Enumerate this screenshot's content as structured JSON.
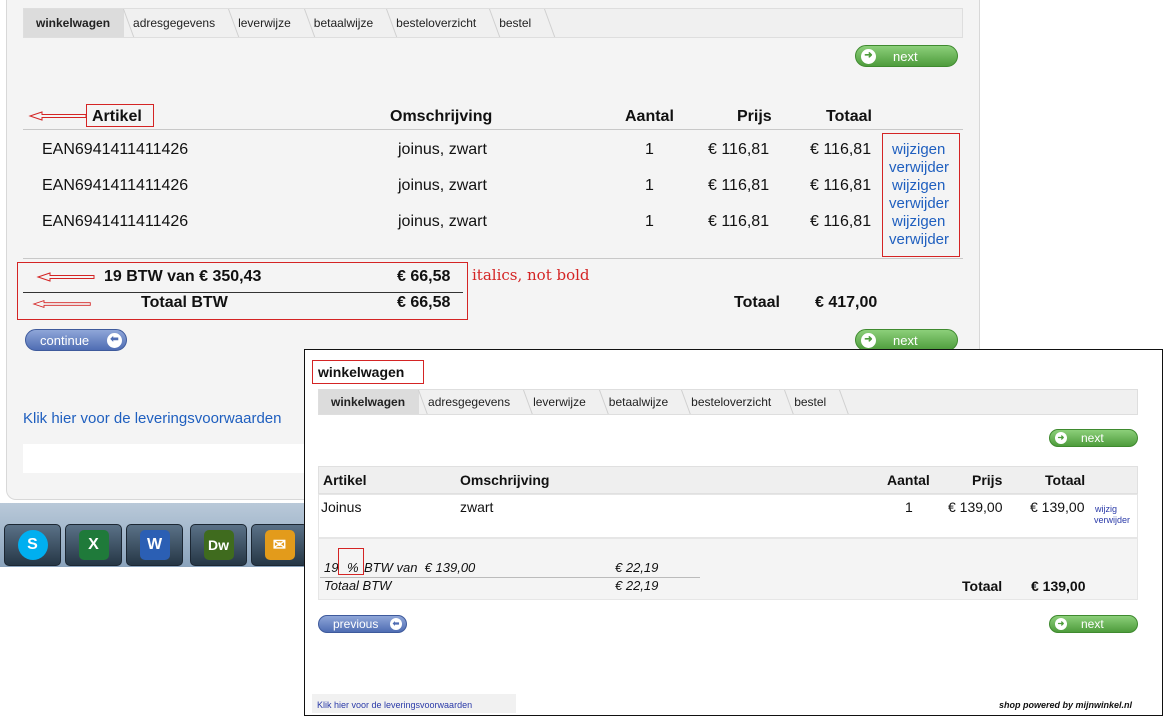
{
  "main": {
    "steps": [
      "winkelwagen",
      "adresgegevens",
      "leverwijze",
      "betaalwijze",
      "besteloverzicht",
      "bestel"
    ],
    "next_label": "next",
    "continue_label": "continue",
    "columns": {
      "artikel": "Artikel",
      "omschrijving": "Omschrijving",
      "aantal": "Aantal",
      "prijs": "Prijs",
      "totaal": "Totaal"
    },
    "rows": [
      {
        "artikel": "EAN6941411411426",
        "omschrijving": "joinus, zwart",
        "aantal": "1",
        "prijs": "€ 116,81",
        "totaal": "€ 116,81",
        "edit": "wijzigen",
        "remove": "verwijder"
      },
      {
        "artikel": "EAN6941411411426",
        "omschrijving": "joinus, zwart",
        "aantal": "1",
        "prijs": "€ 116,81",
        "totaal": "€ 116,81",
        "edit": "wijzigen",
        "remove": "verwijder"
      },
      {
        "artikel": "EAN6941411411426",
        "omschrijving": "joinus, zwart",
        "aantal": "1",
        "prijs": "€ 116,81",
        "totaal": "€ 116,81",
        "edit": "wijzigen",
        "remove": "verwijder"
      }
    ],
    "btw_line": {
      "label": "19 BTW van € 350,43",
      "value": "€ 66,58"
    },
    "totaal_btw": {
      "label": "Totaal BTW",
      "value": "€ 66,58"
    },
    "totaal": {
      "label": "Totaal",
      "value": "€ 417,00"
    },
    "annotation": "italics, not bold",
    "delivery_link": "Klik hier voor de leveringsvoorwaarden"
  },
  "inset": {
    "title": "winkelwagen",
    "steps": [
      "winkelwagen",
      "adresgegevens",
      "leverwijze",
      "betaalwijze",
      "besteloverzicht",
      "bestel"
    ],
    "next_label": "next",
    "previous_label": "previous",
    "columns": {
      "artikel": "Artikel",
      "omschrijving": "Omschrijving",
      "aantal": "Aantal",
      "prijs": "Prijs",
      "totaal": "Totaal"
    },
    "row": {
      "artikel": "Joinus",
      "omschrijving": "zwart",
      "aantal": "1",
      "prijs": "€ 139,00",
      "totaal": "€ 139,00",
      "edit": "wijzig",
      "remove": "verwijder"
    },
    "btw_pct": "19",
    "btw_sign": "%",
    "btw_label": "BTW van  € 139,00",
    "btw_value": "€ 22,19",
    "totaal_btw": {
      "label": "Totaal BTW",
      "value": "€ 22,19"
    },
    "totaal": {
      "label": "Totaal",
      "value": "€ 139,00"
    },
    "delivery_link": "Klik hier voor de leveringsvoorwaarden",
    "powered": "shop powered by mijnwinkel.nl"
  },
  "taskbar": {
    "apps": [
      {
        "icon": "skype-icon",
        "glyph": "S",
        "color": "#00aff0"
      },
      {
        "icon": "excel-icon",
        "glyph": "X",
        "color": "#1f7a3a"
      },
      {
        "icon": "word-icon",
        "glyph": "W",
        "color": "#2b5fb4"
      },
      {
        "icon": "dreamweaver-icon",
        "glyph": "Dw",
        "color": "#3f6b1e"
      },
      {
        "icon": "outlook-icon",
        "glyph": "✉",
        "color": "#e39b1b"
      }
    ]
  }
}
